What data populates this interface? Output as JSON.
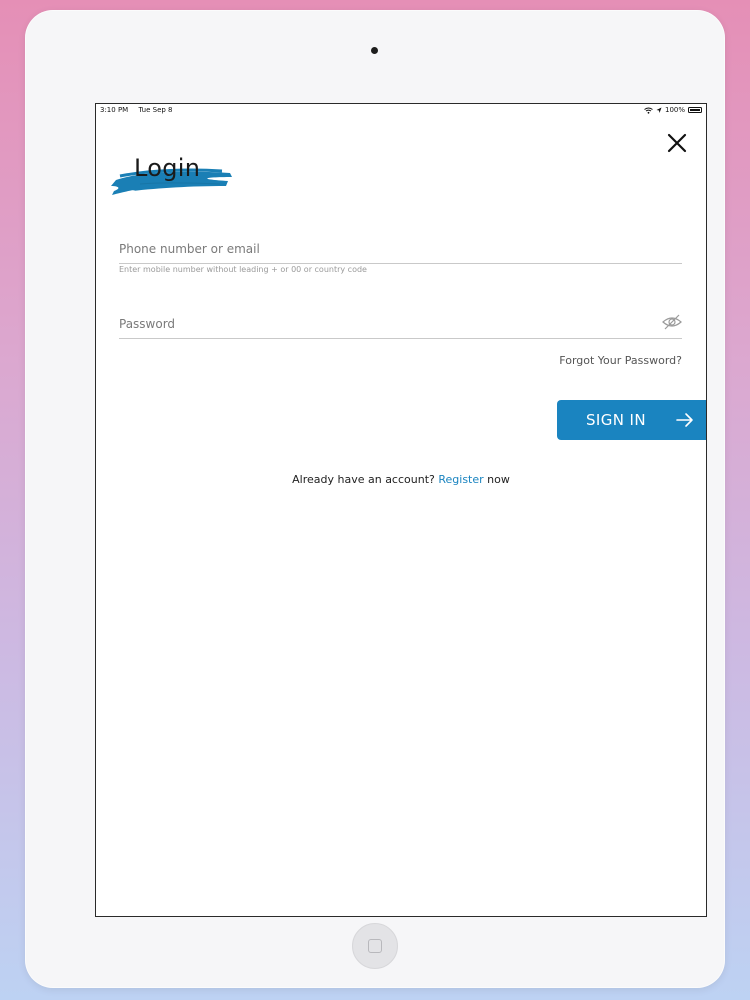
{
  "status_bar": {
    "time": "3:10 PM",
    "date": "Tue Sep 8",
    "battery": "100%",
    "icons": [
      "wifi-icon",
      "location-icon",
      "battery-icon"
    ]
  },
  "header": {
    "title": "Login",
    "close_icon": "close-icon"
  },
  "form": {
    "email": {
      "placeholder": "Phone number or email",
      "value": "",
      "hint": "Enter mobile number without leading + or 00 or country code"
    },
    "password": {
      "placeholder": "Password",
      "value": "",
      "toggle_icon": "eye-off-icon"
    },
    "forgot_label": "Forgot Your Password?",
    "sign_in_label": "SIGN IN",
    "sign_in_icon": "arrow-right-icon"
  },
  "footer": {
    "prefix": "Already have an account?",
    "link": "Register",
    "suffix": "now"
  },
  "colors": {
    "accent": "#1a84c0",
    "brush": "#1a7fb5",
    "background_top": "#e58fb6",
    "background_bottom": "#bdd2f3"
  }
}
